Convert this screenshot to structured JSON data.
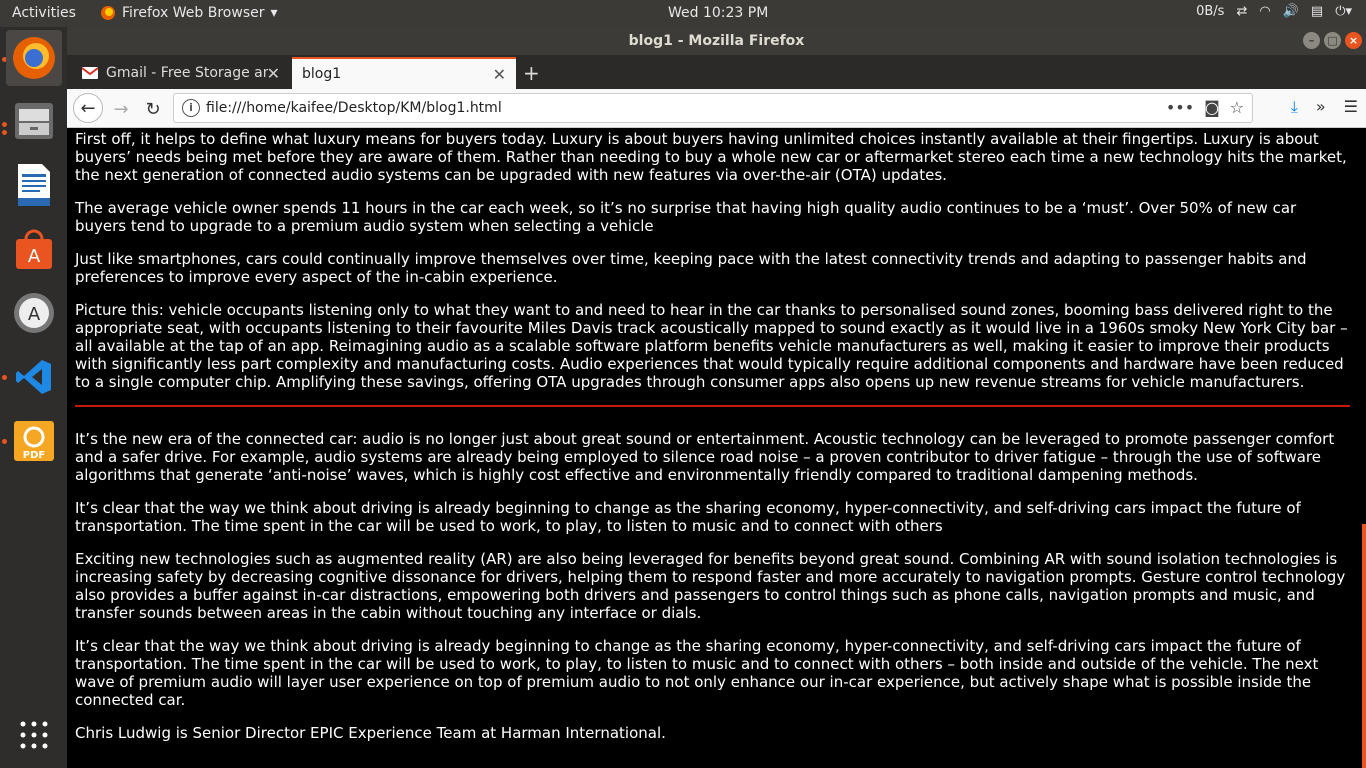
{
  "topbar": {
    "activities": "Activities",
    "app_name": "Firefox Web Browser",
    "clock": "Wed 10:23 PM",
    "net_speed": "0B/s"
  },
  "window": {
    "title": "blog1 - Mozilla Firefox"
  },
  "tabs": [
    {
      "label": "Gmail - Free Storage and",
      "icon": "gmail-icon"
    },
    {
      "label": "blog1",
      "icon": "none",
      "active": true
    }
  ],
  "navbar": {
    "url": "file:///home/kaifee/Desktop/KM/blog1.html"
  },
  "article": {
    "paragraphs_top": [
      "First off, it helps to define what luxury means for buyers today. Luxury is about buyers having unlimited choices instantly available at their fingertips. Luxury is about buyers’ needs being met before they are aware of them. Rather than needing to buy a whole new car or aftermarket stereo each time a new technology hits the market, the next generation of connected audio systems can be upgraded with new features via over-the-air (OTA) updates.",
      "The average vehicle owner spends 11 hours in the car each week, so it’s no surprise that having high quality audio continues to be a ‘must’. Over 50% of new car buyers tend to upgrade to a premium audio system when selecting a vehicle",
      "Just like smartphones, cars could continually improve themselves over time, keeping pace with the latest connectivity trends and adapting to passenger habits and preferences to improve every aspect of the in-cabin experience.",
      "Picture this: vehicle occupants listening only to what they want to and need to hear in the car thanks to personalised sound zones, booming bass delivered right to the appropriate  seat, with occupants listening to their favourite Miles Davis track acoustically mapped to sound exactly as it would live in a 1960s smoky New York City bar – all available at the tap of an app. Reimagining audio as a scalable software platform benefits vehicle manufacturers as well, making it easier to improve their products with significantly less part complexity and manufacturing costs. Audio experiences that would typically require additional components and hardware have been reduced to a single computer chip. Amplifying these savings, offering OTA upgrades through consumer apps also opens up new revenue streams for vehicle manufacturers."
    ],
    "paragraphs_bottom": [
      "It’s the new era of the connected car: audio is no longer just about great sound or entertainment. Acoustic technology can be leveraged to promote passenger comfort and a safer drive. For example, audio systems are already being employed to silence road noise – a proven contributor to driver fatigue – through the use of software algorithms that generate ‘anti-noise’ waves, which is highly cost effective and environmentally friendly compared to traditional dampening methods.",
      "It’s clear that the way we think about driving is already beginning to change as the sharing economy, hyper-connectivity, and self-driving cars impact the future of transportation. The time spent in the car will be used to work, to play, to listen to music and to connect with others",
      "Exciting new technologies such as augmented reality (AR) are also being leveraged for benefits beyond great sound. Combining AR with sound isolation technologies is increasing safety by decreasing cognitive dissonance for drivers, helping them to respond faster and more accurately to navigation prompts. Gesture control technology also provides a buffer against in-car distractions, empowering both drivers and passengers to control things such as phone calls, navigation prompts and music, and transfer sounds between areas in the cabin without touching any interface or dials.",
      "It’s clear that the way we think about driving is already beginning to change as the sharing economy, hyper-connectivity, and self-driving cars impact the future of transportation. The time spent in the car will be used to work, to play, to listen to music and to connect with others – both inside and outside of the vehicle. The next wave of premium audio will layer user experience on top of premium audio to not only enhance our in-car experience, but actively shape what is possible inside the connected car.",
      "Chris Ludwig is Senior Director EPIC Experience Team at Harman International."
    ]
  },
  "colors": {
    "accent": "#e95420",
    "divider": "#c8170b",
    "page_bg": "#000000",
    "text": "#ffffff"
  }
}
